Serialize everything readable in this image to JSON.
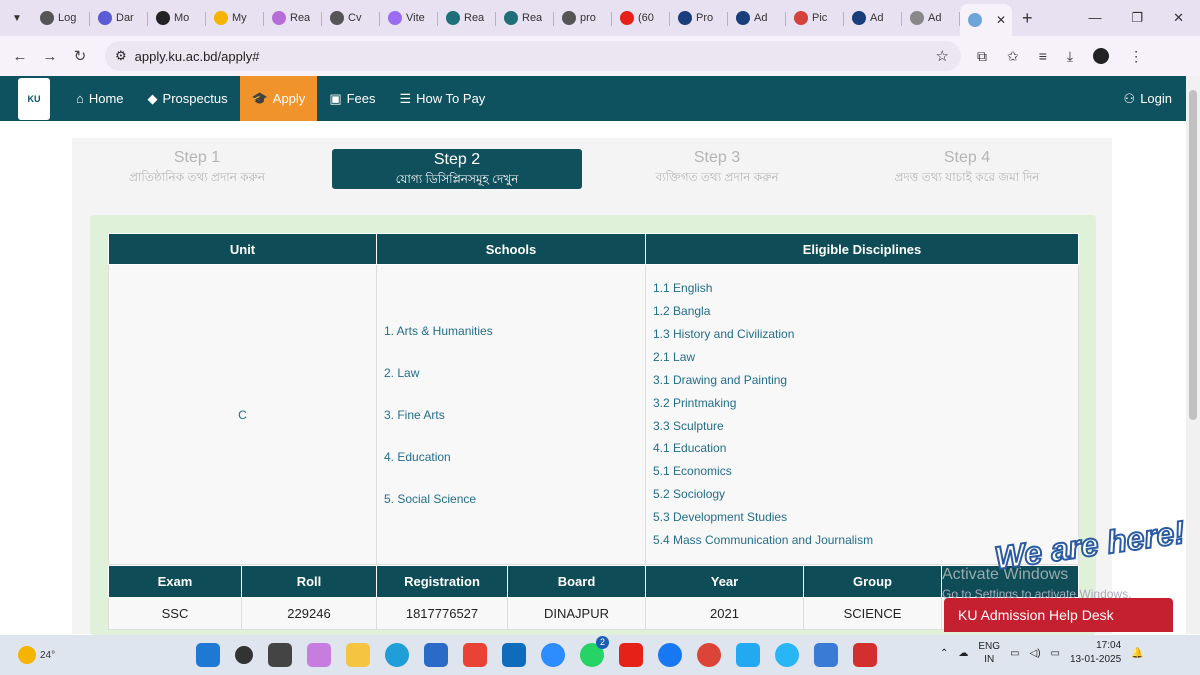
{
  "browser": {
    "tabs": [
      {
        "title": "Log",
        "color": "#555"
      },
      {
        "title": "Dar",
        "color": "#5b5bd6"
      },
      {
        "title": "Mo",
        "color": "#222"
      },
      {
        "title": "My",
        "color": "#f4b400"
      },
      {
        "title": "Rea",
        "color": "#b66dd8"
      },
      {
        "title": "Cv",
        "color": "#555"
      },
      {
        "title": "Vite",
        "color": "#9b6bf2"
      },
      {
        "title": "Rea",
        "color": "#1f6f78"
      },
      {
        "title": "Rea",
        "color": "#1f6f78"
      },
      {
        "title": "pro",
        "color": "#555"
      },
      {
        "title": "(60",
        "color": "#e62117"
      },
      {
        "title": "Pro",
        "color": "#1a3d7c"
      },
      {
        "title": "Ad",
        "color": "#1a3d7c"
      },
      {
        "title": "Pic",
        "color": "#d4423c"
      },
      {
        "title": "Ad",
        "color": "#1a3d7c"
      },
      {
        "title": "Ad",
        "color": "#888"
      }
    ],
    "url": "apply.ku.ac.bd/apply#"
  },
  "navbar": {
    "logo_text": "KU",
    "items": [
      {
        "label": "Home",
        "icon": "home-icon",
        "active": false
      },
      {
        "label": "Prospectus",
        "icon": "tag-icon",
        "active": false
      },
      {
        "label": "Apply",
        "icon": "graduation-cap-icon",
        "active": true
      },
      {
        "label": "Fees",
        "icon": "money-icon",
        "active": false
      },
      {
        "label": "How To Pay",
        "icon": "list-icon",
        "active": false
      }
    ],
    "login_label": "Login"
  },
  "steps": [
    {
      "title": "Step 1",
      "subtitle": "প্রাতিষ্ঠানিক তথ্য প্রদান করুন",
      "active": false
    },
    {
      "title": "Step 2",
      "subtitle": "যোগ্য ডিসিপ্লিনসমূহ দেখুন",
      "active": true
    },
    {
      "title": "Step 3",
      "subtitle": "ব্যক্তিগত তথ্য প্রদান করুন",
      "active": false
    },
    {
      "title": "Step 4",
      "subtitle": "প্রদত্ত তথ্য যাচাই করে জমা দিন",
      "active": false
    }
  ],
  "eligibility_table": {
    "headers": [
      "Unit",
      "Schools",
      "Eligible Disciplines"
    ],
    "unit": "C",
    "schools": [
      "1. Arts & Humanities",
      "2. Law",
      "3. Fine Arts",
      "4. Education",
      "5. Social Science"
    ],
    "disciplines": [
      "1.1 English",
      "1.2 Bangla",
      "1.3 History and Civilization",
      "2.1 Law",
      "3.1 Drawing and Painting",
      "3.2 Printmaking",
      "3.3 Sculpture",
      "4.1 Education",
      "5.1 Economics",
      "5.2 Sociology",
      "5.3 Development Studies",
      "5.4 Mass Communication and Journalism"
    ]
  },
  "exam_table": {
    "headers": [
      "Exam",
      "Roll",
      "Registration",
      "Board",
      "Year",
      "Group"
    ],
    "rows": [
      [
        "SSC",
        "229246",
        "1817776527",
        "DINAJPUR",
        "2021",
        "SCIENCE"
      ]
    ]
  },
  "overlay": {
    "windows_watermark": "Activate Windows",
    "windows_watermark_sub": "Go to Settings to activate Windows.",
    "we_are_here": "We are here!",
    "help_desk": "KU Admission Help Desk"
  },
  "taskbar": {
    "temperature": "24°",
    "language": "ENG",
    "region": "IN",
    "time": "17:04",
    "date": "13-01-2025",
    "whatsapp_badge": "2"
  }
}
